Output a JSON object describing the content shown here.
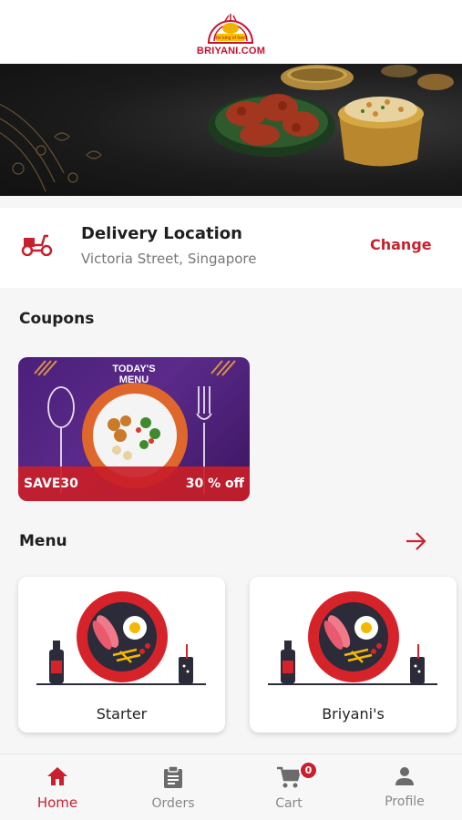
{
  "header": {
    "brand_text": "BRIYANI.COM",
    "tagline": "the king of food"
  },
  "delivery": {
    "title": "Delivery Location",
    "address": "Victoria Street, Singapore",
    "change_label": "Change"
  },
  "coupons": {
    "section_title": "Coupons",
    "items": [
      {
        "banner_title": "TODAY'S MENU",
        "code": "SAVE30",
        "discount": "30 % off"
      }
    ]
  },
  "menu": {
    "section_title": "Menu",
    "items": [
      {
        "label": "Starter"
      },
      {
        "label": "Briyani's"
      }
    ]
  },
  "bottom_nav": {
    "items": [
      {
        "label": "Home",
        "icon": "home-icon",
        "active": true
      },
      {
        "label": "Orders",
        "icon": "clipboard-icon",
        "active": false
      },
      {
        "label": "Cart",
        "icon": "cart-icon",
        "active": false,
        "badge": "0"
      },
      {
        "label": "Profile",
        "icon": "person-icon",
        "active": false
      }
    ]
  },
  "colors": {
    "accent": "#c8202e",
    "coupon_bg": "#4a1f7a",
    "background": "#f6f6f6"
  }
}
